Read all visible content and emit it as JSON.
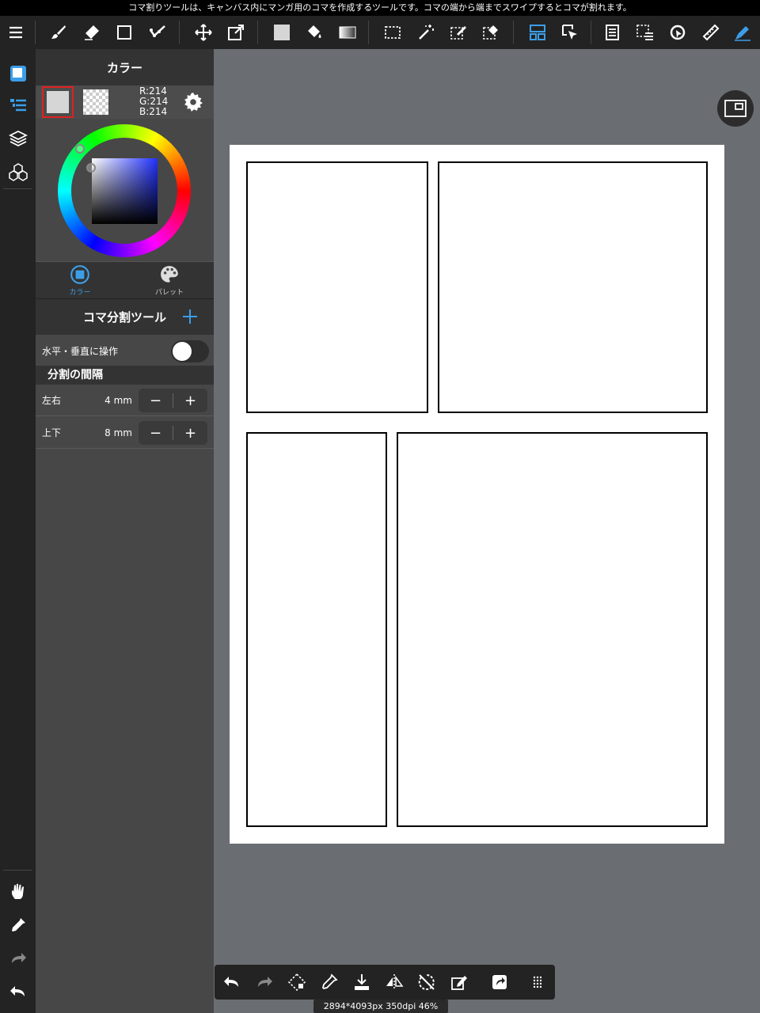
{
  "hint_bar": {
    "text": "コマ割りツールは、キャンバス内にマンガ用のコマを作成するツールです。コマの端から端までスワイプするとコマが割れます。"
  },
  "toolbar": {
    "items": [
      "menu-icon",
      "brush-icon",
      "eraser-icon",
      "rectangle-icon",
      "stabilizer-icon",
      "move-icon",
      "transform-icon",
      "fill-color-icon",
      "bucket-icon",
      "gradient-icon",
      "lasso-select-icon",
      "magic-wand-icon",
      "select-pen-icon",
      "select-eraser-icon",
      "panel-divide-icon",
      "object-select-icon",
      "text-icon",
      "select-menu-icon",
      "snap-icon",
      "ruler-icon",
      "pen-icon"
    ],
    "active": "panel-divide-icon",
    "accent": "#3c9ee8"
  },
  "rail": {
    "items": [
      "color-panel-icon",
      "brush-list-icon",
      "layers-icon",
      "materials-icon"
    ],
    "bottom": [
      "hand-icon",
      "eyedropper-icon",
      "redo-icon",
      "undo-icon"
    ]
  },
  "color_panel": {
    "title": "カラー",
    "rgb": {
      "r": "R:214",
      "g": "G:214",
      "b": "B:214"
    },
    "main_color": "#d6d6d6",
    "tabs": [
      {
        "label": "カラー",
        "active": true
      },
      {
        "label": "パレット",
        "active": false
      }
    ]
  },
  "tool_panel": {
    "title": "コマ分割ツール",
    "toggle_label": "水平・垂直に操作",
    "toggle_on": false,
    "spacing_heading": "分割の間隔",
    "rows": [
      {
        "label": "左右",
        "value": "4 mm"
      },
      {
        "label": "上下",
        "value": "8 mm"
      }
    ],
    "minus": "−",
    "plus": "+"
  },
  "canvas": {
    "info": "2894*4093px 350dpi 46%"
  },
  "bottom_bar": {
    "items": [
      "undo-icon",
      "redo-icon",
      "transform-select-icon",
      "eyedropper-icon",
      "import-icon",
      "flip-icon",
      "rotate-reset-icon",
      "edit-icon",
      "share-icon",
      "more-icon"
    ]
  }
}
